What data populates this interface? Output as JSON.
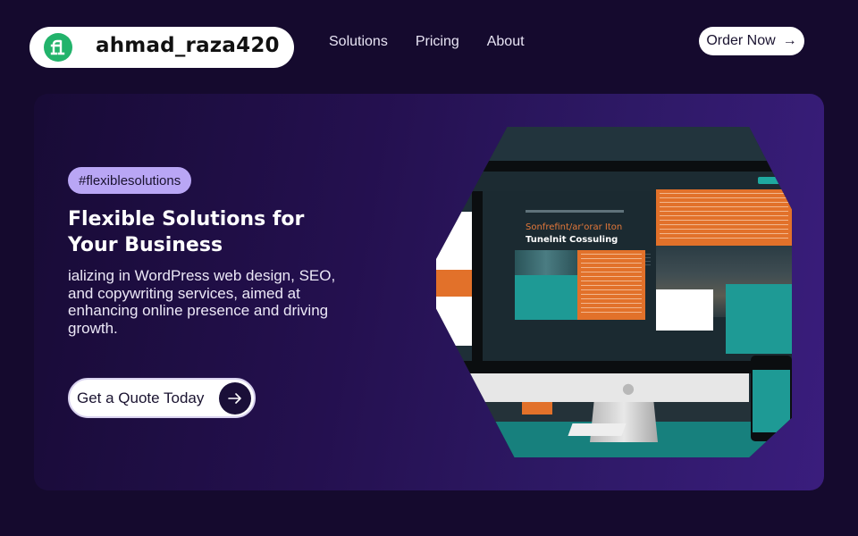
{
  "header": {
    "brand": {
      "logo_icon": "fi-logo-icon",
      "logo_text": "fi",
      "name": "ahmad_raza420"
    },
    "nav": [
      {
        "label": "Solutions"
      },
      {
        "label": "Pricing"
      },
      {
        "label": "About"
      }
    ],
    "order_button": {
      "label": "Order Now",
      "icon": "arrow-right-icon",
      "icon_glyph": "→"
    }
  },
  "hero": {
    "tag": "#flexiblesolutions",
    "title_line1": "Flexible Solutions for",
    "title_line2": "Your Business",
    "description": "ializing in WordPress web design, SEO, and copywriting services, aimed at enhancing online presence and driving growth.",
    "cta": {
      "label": "Get a Quote Today",
      "icon": "arrow-right-icon",
      "icon_glyph": "→"
    },
    "image": {
      "alt": "Website mockup on desktop monitor and phone",
      "mockup_headline_1": "Sonfrefint/ar'orar Iton",
      "mockup_headline_2": "Tunelnit Cossuling"
    }
  },
  "colors": {
    "page_background": "#150a2e",
    "hero_gradient_start": "#180b36",
    "hero_gradient_end": "#3a1d7d",
    "tag_background": "#b9a6f5",
    "logo_green": "#22b36b",
    "mockup_orange": "#e2712a",
    "mockup_teal": "#1e9a95"
  }
}
